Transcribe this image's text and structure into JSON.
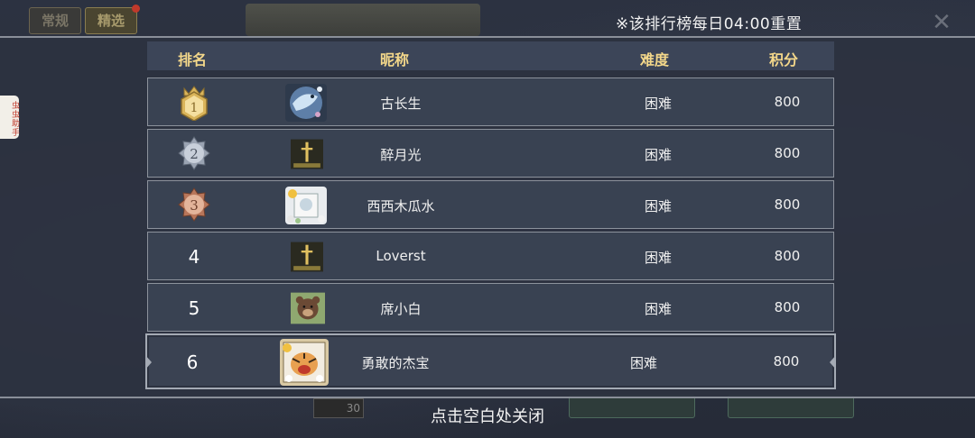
{
  "background": {
    "tabs": [
      {
        "label": "常规",
        "active": false
      },
      {
        "label": "精选",
        "active": true
      }
    ],
    "box_value": "30"
  },
  "reset_note": "※该排行榜每日04:00重置",
  "side_helper": "虫虫助手",
  "header": {
    "rank": "排名",
    "nickname": "昵称",
    "difficulty": "难度",
    "score": "积分"
  },
  "rows": [
    {
      "rank": "1",
      "badge": "gold",
      "avatar": "ice-fish-avatar",
      "nickname": "古长生",
      "difficulty": "困难",
      "score": "800"
    },
    {
      "rank": "2",
      "badge": "silver",
      "avatar": "sword-avatar",
      "nickname": "醉月光",
      "difficulty": "困难",
      "score": "800"
    },
    {
      "rank": "3",
      "badge": "bronze",
      "avatar": "flower-bee-avatar",
      "nickname": "西西木瓜水",
      "difficulty": "困难",
      "score": "800"
    },
    {
      "rank": "4",
      "badge": null,
      "avatar": "sword-avatar",
      "nickname": "Loverst",
      "difficulty": "困难",
      "score": "800"
    },
    {
      "rank": "5",
      "badge": null,
      "avatar": "bear-avatar",
      "nickname": "席小白",
      "difficulty": "困难",
      "score": "800"
    },
    {
      "rank": "6",
      "badge": null,
      "avatar": "tiger-avatar",
      "nickname": "勇敢的杰宝",
      "difficulty": "困难",
      "score": "800",
      "is_self": true
    }
  ],
  "close_hint": "点击空白处关闭",
  "colors": {
    "header_text": "#f3d78a",
    "gold": "#d9b45a",
    "silver": "#9aa3b2",
    "bronze": "#b8765a"
  }
}
